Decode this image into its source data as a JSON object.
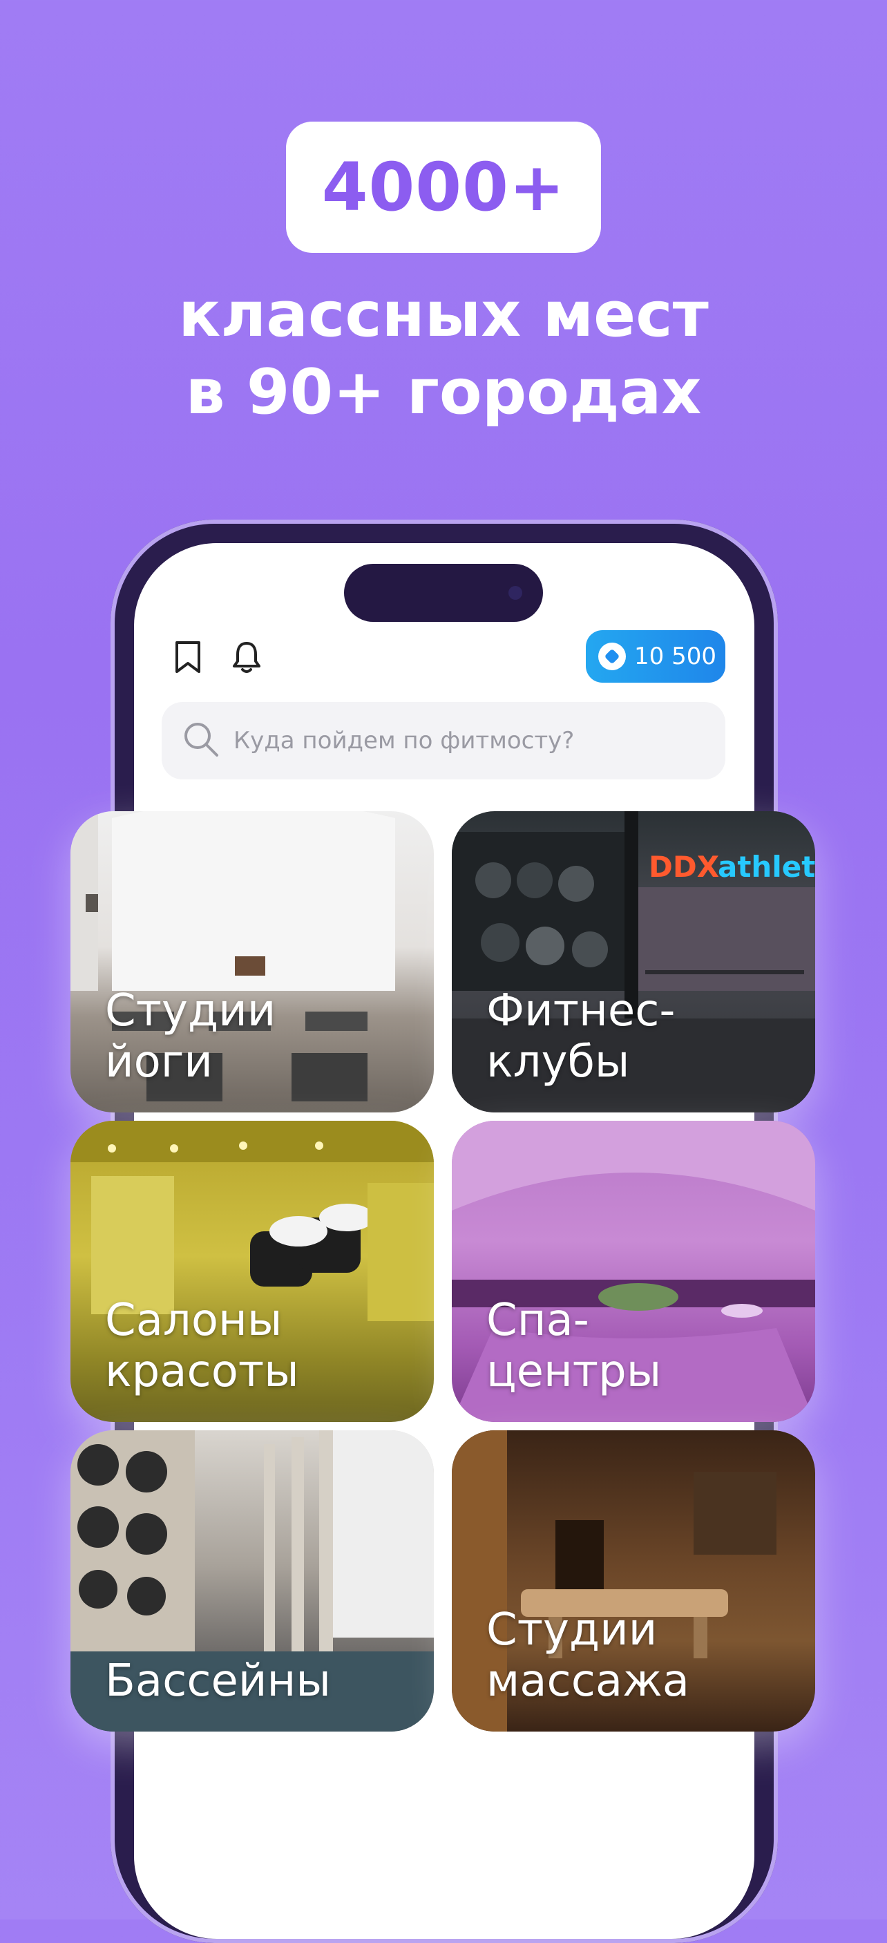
{
  "hero": {
    "count": "4000+",
    "line1": "классных мест",
    "line2": "в 90+ городах"
  },
  "app": {
    "balance": "10 500",
    "search_placeholder": "Куда пойдем по фитмосту?",
    "icons": [
      "bookmark-icon",
      "bell-icon",
      "coin-icon",
      "search-icon"
    ]
  },
  "categories": [
    {
      "line1": "Студии",
      "line2": "йоги"
    },
    {
      "line1": "Фитнес-",
      "line2": "клубы",
      "sign": "DDX athlet"
    },
    {
      "line1": "Салоны",
      "line2": "красоты"
    },
    {
      "line1": "Спа-",
      "line2": "центры"
    },
    {
      "line1": "Бассейны",
      "line2": ""
    },
    {
      "line1": "Студии",
      "line2": "массажа"
    }
  ],
  "colors": {
    "background": "#9c77f3",
    "accent": "#8c5df0",
    "balance_button": "#1f8fee"
  }
}
